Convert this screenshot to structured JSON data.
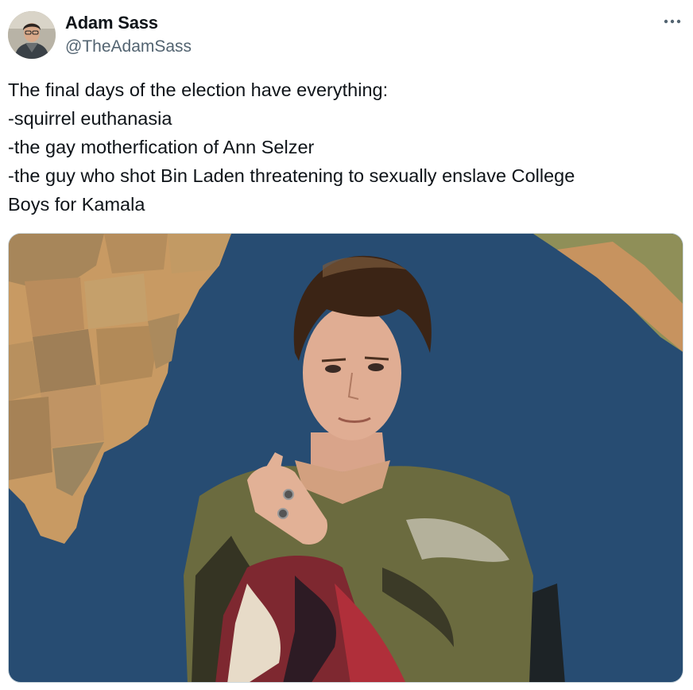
{
  "author": {
    "display_name": "Adam Sass",
    "handle": "@TheAdamSass",
    "avatar_icon": "profile-photo"
  },
  "menu": {
    "icon": "more-horizontal-icon"
  },
  "tweet": {
    "lines": [
      "The final days of the election have everything:",
      "-squirrel euthanasia",
      "-the gay motherfication of Ann Selzer",
      "-the guy who shot Bin Laden threatening to sexually enslave College",
      "Boys for Kamala"
    ]
  },
  "colors": {
    "text": "#0f1419",
    "secondary": "#536471",
    "border": "#cfd9de",
    "map_ocean": "#264d73"
  }
}
